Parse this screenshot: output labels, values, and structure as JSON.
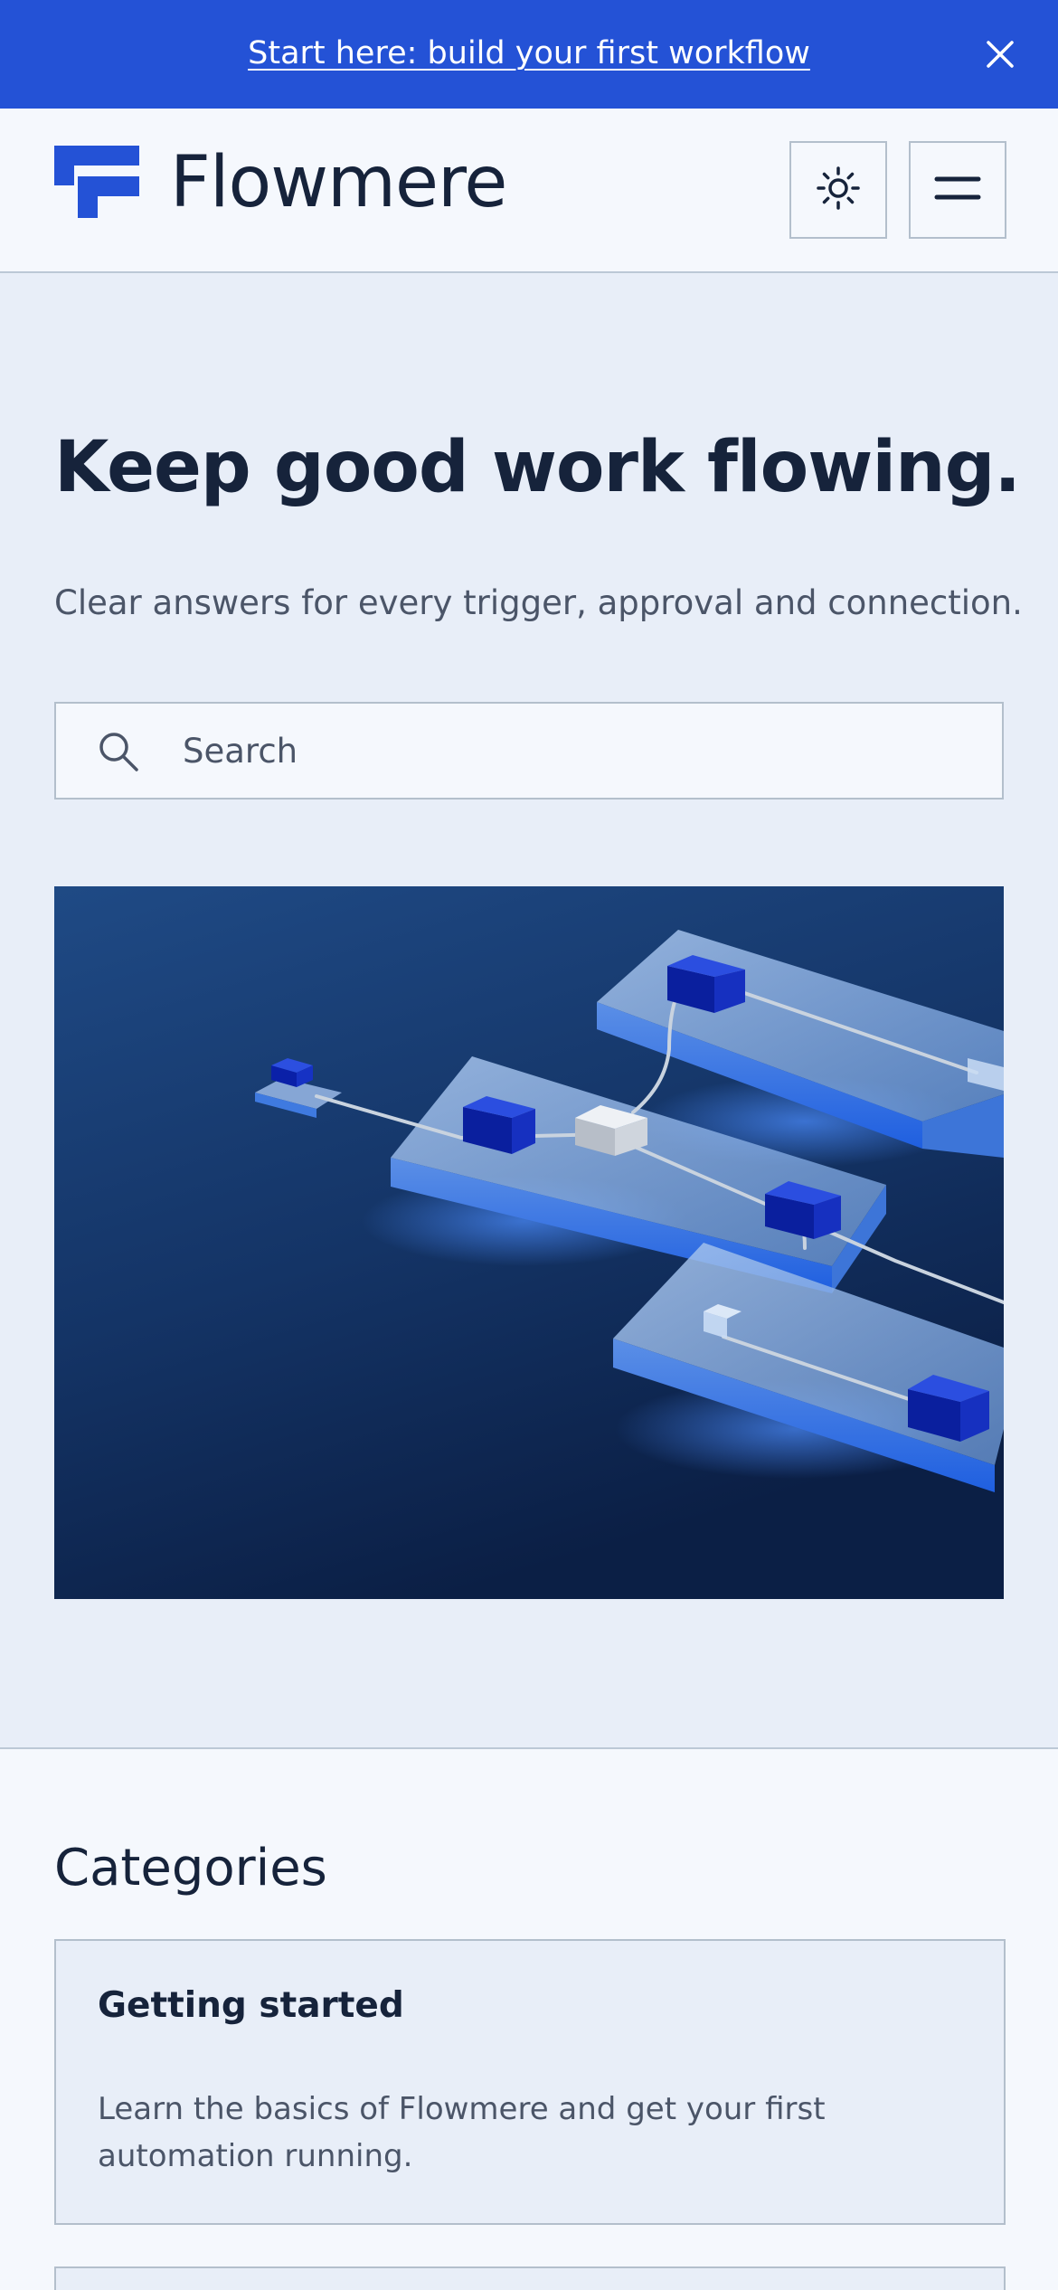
{
  "banner": {
    "link_text": "Start here: build your first workflow",
    "close_icon": "close-icon"
  },
  "header": {
    "brand": "Flowmere",
    "logo_icon": "flowmere-logo-icon",
    "theme_toggle_icon": "sun-icon",
    "menu_icon": "hamburger-menu-icon"
  },
  "hero": {
    "title": "Keep good work flowing.",
    "subtitle": "Clear answers for every trigger, approval and connection.",
    "search_placeholder": "Search",
    "search_icon": "search-icon",
    "image_description_icon": "workflow-blocks-illustration"
  },
  "categories": {
    "heading": "Categories",
    "items": [
      {
        "title": "Getting started",
        "description": "Learn the basics of Flowmere and get your first automation running."
      }
    ]
  },
  "colors": {
    "banner_bg": "#2452d6",
    "brand_blue": "#2452d6",
    "text_dark": "#16233b",
    "text_muted": "#4b5568",
    "hero_bg": "#e8eef8",
    "page_bg": "#f5f8fd",
    "border": "#b3bfcc"
  }
}
